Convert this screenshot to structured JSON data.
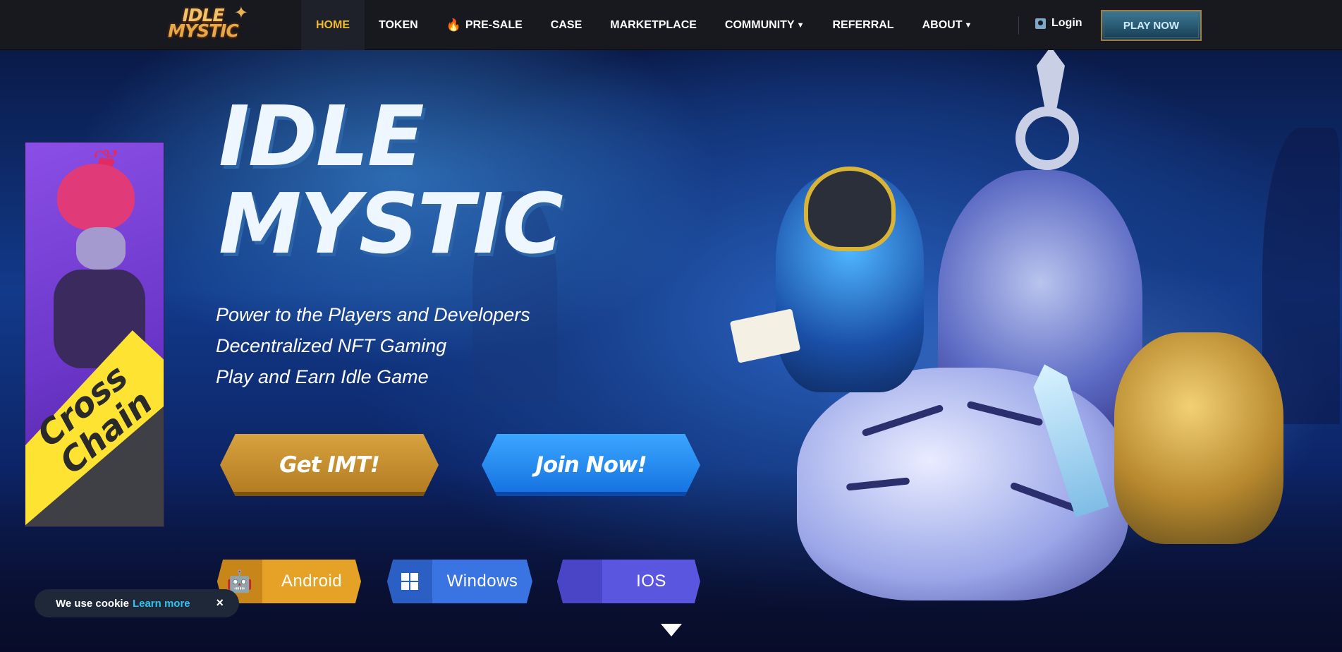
{
  "nav": {
    "logo_line1": "IDLE",
    "logo_line2": "MYSTIC",
    "items": [
      {
        "label": "HOME",
        "active": true
      },
      {
        "label": "TOKEN"
      },
      {
        "label": "PRE-SALE",
        "icon": "fire-icon"
      },
      {
        "label": "CASE"
      },
      {
        "label": "MARKETPLACE"
      },
      {
        "label": "COMMUNITY",
        "dropdown": true
      },
      {
        "label": "REFERRAL"
      },
      {
        "label": "ABOUT",
        "dropdown": true
      }
    ],
    "login_label": "Login",
    "play_now_label": "PLAY NOW",
    "active_color": "#f0b92e"
  },
  "banner": {
    "line1": "Cross",
    "line2": "Chain"
  },
  "hero": {
    "title_line1": "IDLE",
    "title_line2": "MYSTIC",
    "taglines": [
      "Power to the Players and Developers",
      "Decentralized NFT Gaming",
      "Play and Earn Idle Game"
    ],
    "get_imt_label": "Get IMT!",
    "join_now_label": "Join Now!",
    "downloads": [
      {
        "label": "Android",
        "icon": "android-icon",
        "color": "#e6a226"
      },
      {
        "label": "Windows",
        "icon": "windows-icon",
        "color": "#3a74e3"
      },
      {
        "label": "IOS",
        "icon": "apple-icon",
        "color": "#5b56e0"
      }
    ]
  },
  "cookie": {
    "text": "We use cookie",
    "link_label": "Learn more",
    "close_glyph": "×"
  }
}
